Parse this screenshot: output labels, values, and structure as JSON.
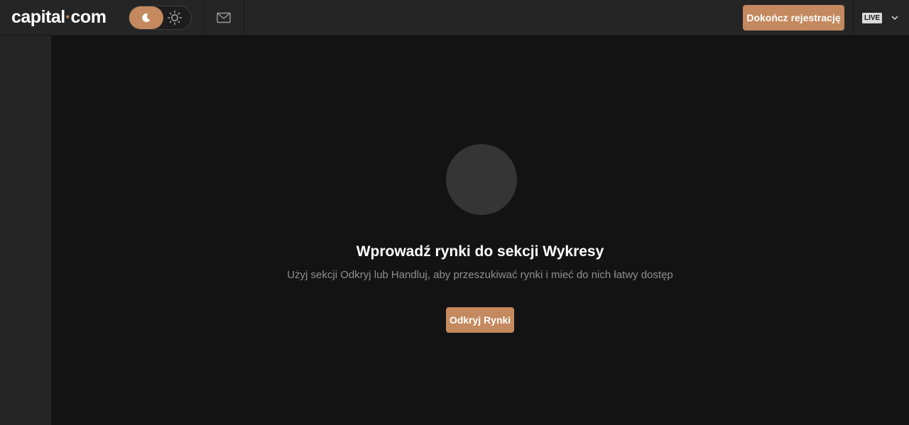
{
  "header": {
    "logo": {
      "part1": "capital",
      "dot": "·",
      "part2": "com"
    },
    "theme_toggle": {
      "active": "dark",
      "icons": [
        "moon-icon",
        "sun-icon"
      ]
    },
    "mail_icon": "envelope-icon",
    "complete_registration_label": "Dokończ rejestrację",
    "account_mode_badge": "LIVE",
    "account_dropdown_icon": "chevron-down-icon"
  },
  "empty_state": {
    "title": "Wprowadź rynki do sekcji Wykresy",
    "subtitle": "Użyj sekcji Odkryj lub Handluj, aby przeszukiwać rynki i mieć do nich łatwy dostęp",
    "button_label": "Odkryj Rynki"
  },
  "colors": {
    "accent": "#c4895e",
    "topbar_bg": "#252525",
    "main_bg": "#131313",
    "sidebar_bg": "#252525",
    "placeholder_circle": "#353535",
    "muted_text": "#8f8f8f"
  }
}
